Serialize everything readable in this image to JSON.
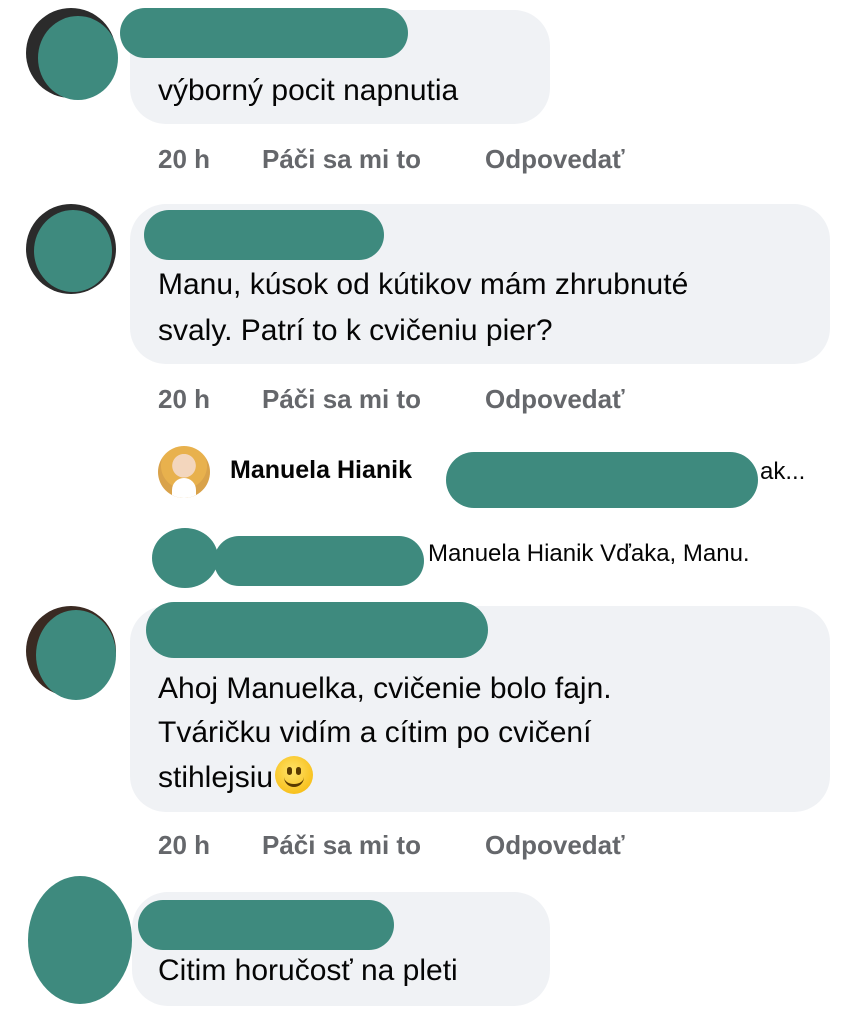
{
  "comments": [
    {
      "text_lines": [
        "výborný pocit napnutia"
      ],
      "meta": {
        "time": "20 h",
        "like": "Páči sa mi to",
        "reply": "Odpovedať"
      }
    },
    {
      "text_lines": [
        "Manu, kúsok od kútikov mám zhrubnuté",
        "svaly. Patrí to k cvičeniu pier?"
      ],
      "meta": {
        "time": "20 h",
        "like": "Páči sa mi to",
        "reply": "Odpovedať"
      }
    },
    {
      "text_lines": [
        "Ahoj Manuelka, cvičenie bolo fajn.",
        "Tváričku vidím a cítim po cvičení",
        "stihlejsiu"
      ],
      "emoji": "slightly-smiling-face-icon",
      "meta": {
        "time": "20 h",
        "like": "Páči sa mi to",
        "reply": "Odpovedať"
      }
    },
    {
      "text_lines": [
        "Citim horučosť na pleti"
      ]
    }
  ],
  "replies": [
    {
      "author": "Manuela Hianik",
      "text_end": "ak..."
    },
    {
      "text": "Manuela Hianik Vďaka, Manu."
    }
  ],
  "colors": {
    "bubble": "#f0f2f5",
    "meta": "#65676b",
    "redaction": "#3e8a7e"
  }
}
